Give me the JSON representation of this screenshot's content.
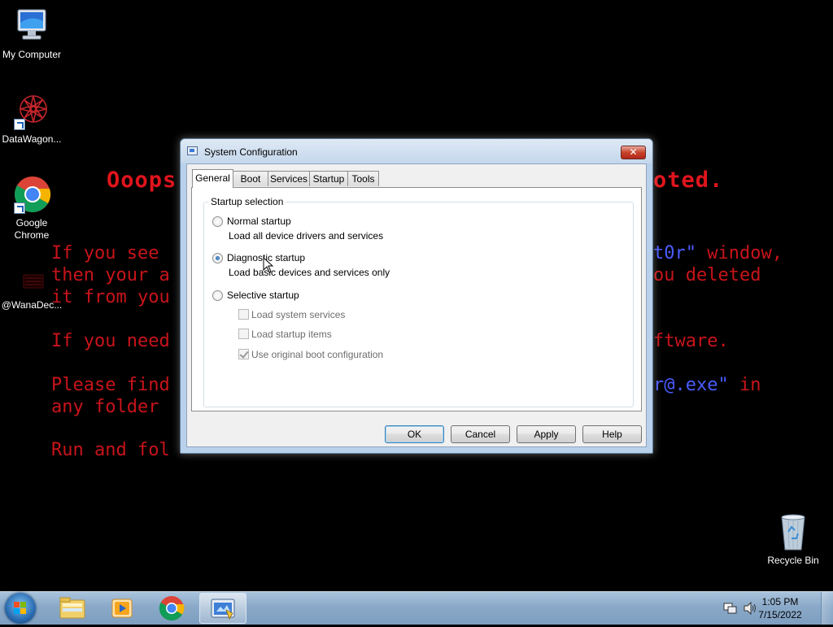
{
  "wallpaper": {
    "headline_left": "Ooops",
    "headline_right": "oted.",
    "line1_left": "If you see ",
    "line1_right_blue": "t0r\"",
    "line1_right": " window,",
    "line2_left": "then your a",
    "line2_right": "ou deleted",
    "line3_left": "it from you",
    "line4_left": "If you need",
    "line4_right": "ftware.",
    "line5_left": "Please find",
    "line5_right_blue": "r@.exe\"",
    "line5_right": " in",
    "line6_left": "any folder ",
    "line7_left": "Run and fol"
  },
  "desktop_icons": [
    {
      "label": "My Computer",
      "icon": "computer-icon"
    },
    {
      "label": "DataWagon...",
      "icon": "datawagon-icon"
    },
    {
      "label": "Google Chrome",
      "icon": "chrome-icon"
    },
    {
      "label": "@WanaDec...",
      "icon": "wanadecryptor-icon"
    },
    {
      "label": "Recycle Bin",
      "icon": "recycle-bin-icon"
    }
  ],
  "dialog": {
    "title": "System Configuration",
    "close_label": "✕",
    "tabs": [
      "General",
      "Boot",
      "Services",
      "Startup",
      "Tools"
    ],
    "active_tab": "General",
    "group_label": "Startup selection",
    "options": [
      {
        "label": "Normal startup",
        "desc": "Load all device drivers and services",
        "checked": false
      },
      {
        "label": "Diagnostic startup",
        "desc": "Load basic devices and services only",
        "checked": true
      },
      {
        "label": "Selective startup",
        "checked": false
      }
    ],
    "selective_items": [
      {
        "label": "Load system services",
        "checked": false,
        "enabled": false
      },
      {
        "label": "Load startup items",
        "checked": false,
        "enabled": false
      },
      {
        "label": "Use original boot configuration",
        "checked": true,
        "enabled": false
      }
    ],
    "buttons": {
      "ok": "OK",
      "cancel": "Cancel",
      "apply": "Apply",
      "help": "Help"
    }
  },
  "taskbar": {
    "pinned": [
      "windows-explorer-icon",
      "media-player-icon",
      "chrome-icon",
      "system-configuration-icon"
    ],
    "time": "1:05 PM",
    "date": "7/15/2022"
  },
  "colors": {
    "wallpaper_text": "#c8141a",
    "wallpaper_link": "#4a5cff",
    "desktop_bg": "#000000"
  }
}
